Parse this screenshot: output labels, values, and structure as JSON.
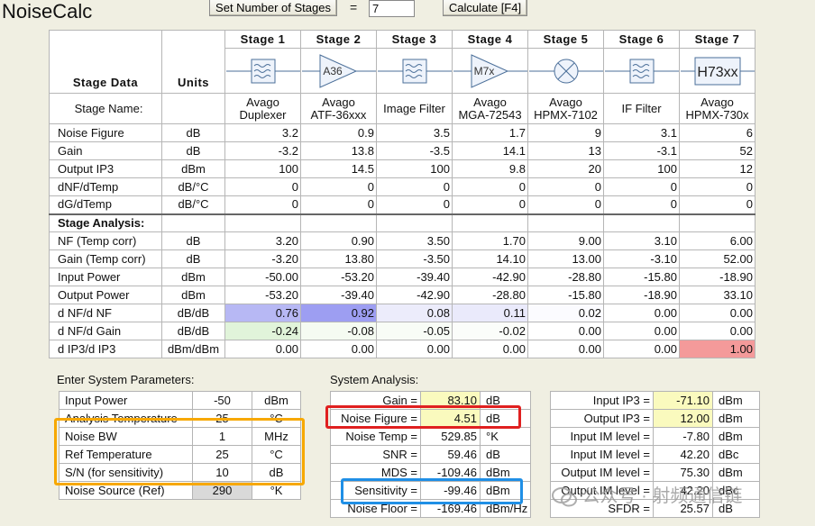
{
  "app": {
    "title": "NoiseCalc"
  },
  "toolbar": {
    "set_stages_label": "Set Number of Stages",
    "equals": "=",
    "stage_count": "7",
    "calculate_label": "Calculate [F4]"
  },
  "grid": {
    "stage_headers": [
      "Stage  1",
      "Stage  2",
      "Stage  3",
      "Stage  4",
      "Stage  5",
      "Stage  6",
      "Stage  7"
    ],
    "col_stage_data": "Stage Data",
    "col_units": "Units",
    "stage_symbols": [
      {
        "icon": "filter-icon",
        "text": ""
      },
      {
        "icon": "amplifier-icon",
        "text": "A36"
      },
      {
        "icon": "filter-icon",
        "text": ""
      },
      {
        "icon": "amplifier-icon",
        "text": "M7x"
      },
      {
        "icon": "mixer-icon",
        "text": ""
      },
      {
        "icon": "filter-icon",
        "text": ""
      },
      {
        "icon": "block-icon",
        "text": "H73xx"
      }
    ],
    "stage_name_label": "Stage Name:",
    "stage_names": [
      [
        "Avago",
        "Duplexer"
      ],
      [
        "Avago",
        "ATF-36xxx"
      ],
      [
        "Image Filter"
      ],
      [
        "Avago",
        "MGA-72543"
      ],
      [
        "Avago",
        "HPMX-7102"
      ],
      [
        "IF Filter"
      ],
      [
        "Avago",
        "HPMX-730x"
      ]
    ],
    "data_rows": [
      {
        "label": "Noise Figure",
        "unit": "dB",
        "values": [
          "3.2",
          "0.9",
          "3.5",
          "1.7",
          "9",
          "3.1",
          "6"
        ]
      },
      {
        "label": "Gain",
        "unit": "dB",
        "values": [
          "-3.2",
          "13.8",
          "-3.5",
          "14.1",
          "13",
          "-3.1",
          "52"
        ]
      },
      {
        "label": "Output IP3",
        "unit": "dBm",
        "values": [
          "100",
          "14.5",
          "100",
          "9.8",
          "20",
          "100",
          "12"
        ]
      },
      {
        "label": "dNF/dTemp",
        "unit": "dB/°C",
        "values": [
          "0",
          "0",
          "0",
          "0",
          "0",
          "0",
          "0"
        ]
      },
      {
        "label": "dG/dTemp",
        "unit": "dB/°C",
        "values": [
          "0",
          "0",
          "0",
          "0",
          "0",
          "0",
          "0"
        ]
      }
    ],
    "analysis_header": "Stage Analysis:",
    "analysis_rows": [
      {
        "label": "NF (Temp corr)",
        "unit": "dB",
        "values": [
          "3.20",
          "0.90",
          "3.50",
          "1.70",
          "9.00",
          "3.10",
          "6.00"
        ]
      },
      {
        "label": "Gain (Temp corr)",
        "unit": "dB",
        "values": [
          "-3.20",
          "13.80",
          "-3.50",
          "14.10",
          "13.00",
          "-3.10",
          "52.00"
        ]
      },
      {
        "label": "Input Power",
        "unit": "dBm",
        "values": [
          "-50.00",
          "-53.20",
          "-39.40",
          "-42.90",
          "-28.80",
          "-15.80",
          "-18.90"
        ]
      },
      {
        "label": "Output Power",
        "unit": "dBm",
        "values": [
          "-53.20",
          "-39.40",
          "-42.90",
          "-28.80",
          "-15.80",
          "-18.90",
          "33.10"
        ]
      },
      {
        "label": "d NF/d NF",
        "unit": "dB/dB",
        "values": [
          "0.76",
          "0.92",
          "0.08",
          "0.11",
          "0.02",
          "0.00",
          "0.00"
        ],
        "colors": [
          "#b7b8f4",
          "#9d9ef2",
          "#ececfb",
          "#eaeafb",
          "#fbfbff",
          "#ffffff",
          "#ffffff"
        ]
      },
      {
        "label": "d NF/d Gain",
        "unit": "dB/dB",
        "values": [
          "-0.24",
          "-0.08",
          "-0.05",
          "-0.02",
          "0.00",
          "0.00",
          "0.00"
        ],
        "colors": [
          "#e1f4da",
          "#f5fbf2",
          "#f8fcf6",
          "#fbfdfa",
          "#ffffff",
          "#ffffff",
          "#ffffff"
        ]
      },
      {
        "label": "d IP3/d IP3",
        "unit": "dBm/dBm",
        "values": [
          "0.00",
          "0.00",
          "0.00",
          "0.00",
          "0.00",
          "0.00",
          "1.00"
        ],
        "colors": [
          "#ffffff",
          "#ffffff",
          "#ffffff",
          "#ffffff",
          "#ffffff",
          "#ffffff",
          "#f49a9a"
        ]
      }
    ]
  },
  "system_params": {
    "title": "Enter System Parameters:",
    "rows": [
      {
        "label": "Input Power",
        "value": "-50",
        "unit": "dBm"
      },
      {
        "label": "Analysis Temperature",
        "value": "25",
        "unit": "°C"
      },
      {
        "label": "Noise BW",
        "value": "1",
        "unit": "MHz"
      },
      {
        "label": "Ref Temperature",
        "value": "25",
        "unit": "°C"
      },
      {
        "label": "S/N (for sensitivity)",
        "value": "10",
        "unit": "dB"
      },
      {
        "label": "Noise Source (Ref)",
        "value": "290",
        "unit": "°K"
      }
    ]
  },
  "system_analysis": {
    "title": "System Analysis:",
    "rows": [
      {
        "label": "Gain =",
        "value": "83.10",
        "unit": "dB"
      },
      {
        "label": "Noise Figure =",
        "value": "4.51",
        "unit": "dB"
      },
      {
        "label": "Noise Temp =",
        "value": "529.85",
        "unit": "°K"
      },
      {
        "label": "SNR =",
        "value": "59.46",
        "unit": "dB"
      },
      {
        "label": "MDS =",
        "value": "-109.46",
        "unit": "dBm"
      },
      {
        "label": "Sensitivity =",
        "value": "-99.46",
        "unit": "dBm"
      },
      {
        "label": "Noise Floor =",
        "value": "-169.46",
        "unit": "dBm/Hz"
      }
    ],
    "right_rows": [
      {
        "label": "Input IP3 =",
        "value": "-71.10",
        "unit": "dBm"
      },
      {
        "label": "Output IP3 =",
        "value": "12.00",
        "unit": "dBm"
      },
      {
        "label": "Input IM level =",
        "value": "-7.80",
        "unit": "dBm"
      },
      {
        "label": "Input IM level =",
        "value": "42.20",
        "unit": "dBc"
      },
      {
        "label": "Output IM level =",
        "value": "75.30",
        "unit": "dBm"
      },
      {
        "label": "Output IM level =",
        "value": "42.20",
        "unit": "dBc"
      },
      {
        "label": "SFDR =",
        "value": "25.57",
        "unit": "dB"
      }
    ]
  },
  "colors": {
    "highlight_yellow": "#fafabe",
    "annotation_orange": "#f7a800",
    "annotation_red": "#e02020",
    "annotation_blue": "#1f8fe6"
  },
  "watermark": {
    "text": "公众号 · 射频通信链"
  }
}
